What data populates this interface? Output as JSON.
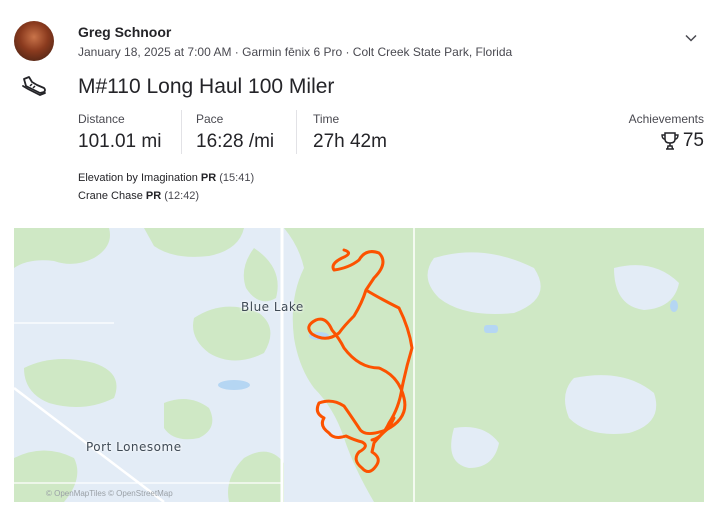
{
  "athlete": {
    "name": "Greg Schnoor"
  },
  "activity": {
    "meta": "January 18, 2025 at 7:00 AM · Garmin fēnix 6 Pro · Colt Creek State Park, Florida",
    "title": "M#110 Long Haul 100 Miler",
    "sport_icon": "shoe-icon"
  },
  "stats": {
    "distance": {
      "label": "Distance",
      "value": "101.01 mi"
    },
    "pace": {
      "label": "Pace",
      "value": "16:28 /mi"
    },
    "time": {
      "label": "Time",
      "value": "27h 42m"
    },
    "achievements": {
      "label": "Achievements",
      "value": "75"
    }
  },
  "segments": [
    {
      "name": "Elevation by Imagination",
      "badge": "PR",
      "time": "(15:41)"
    },
    {
      "name": "Crane Chase",
      "badge": "PR",
      "time": "(12:42)"
    }
  ],
  "map": {
    "places": [
      "Blue Lake",
      "Port Lonesome"
    ],
    "attribution": "© OpenMapTiles © OpenStreetMap",
    "route_color": "#fc5200",
    "land_color": "#e3ecf6",
    "forest_color": "#cfe8c5"
  }
}
